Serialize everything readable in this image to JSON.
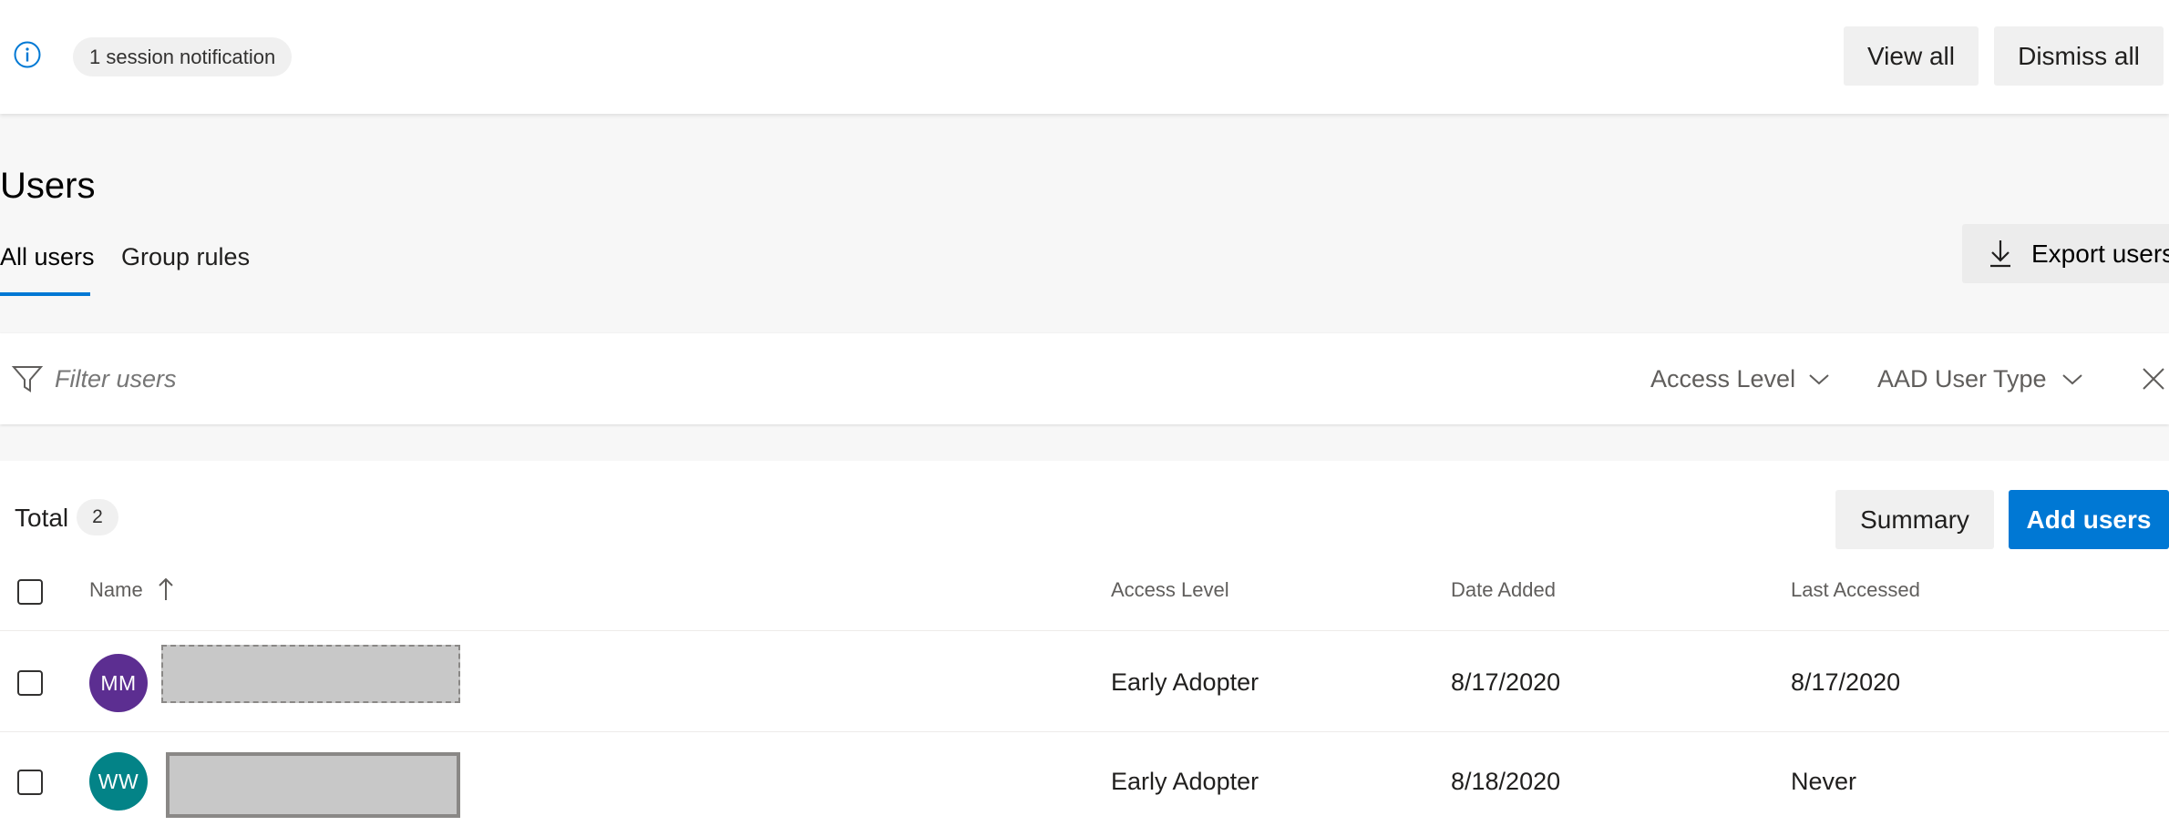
{
  "notification": {
    "text": "1 session notification",
    "view_all": "View all",
    "dismiss_all": "Dismiss all"
  },
  "page": {
    "title": "Users",
    "tabs": [
      {
        "label": "All users",
        "selected": true
      },
      {
        "label": "Group rules",
        "selected": false
      }
    ],
    "export_label": "Export users"
  },
  "filter": {
    "placeholder": "Filter users",
    "dropdowns": [
      {
        "label": "Access Level"
      },
      {
        "label": "AAD User Type"
      }
    ]
  },
  "list": {
    "total_label": "Total",
    "total_count": "2",
    "summary_label": "Summary",
    "add_users_label": "Add users",
    "columns": {
      "name": "Name",
      "access_level": "Access Level",
      "date_added": "Date Added",
      "last_accessed": "Last Accessed"
    },
    "rows": [
      {
        "initials": "MM",
        "avatar_color": "#5c2e91",
        "access_level": "Early Adopter",
        "date_added": "8/17/2020",
        "last_accessed": "8/17/2020"
      },
      {
        "initials": "WW",
        "avatar_color": "#038387",
        "access_level": "Early Adopter",
        "date_added": "8/18/2020",
        "last_accessed": "Never"
      }
    ]
  },
  "colors": {
    "accent": "#0078d4",
    "page_bg": "#f7f7f7"
  },
  "icons": {
    "info": "info-circle-icon",
    "export": "download-arrow-icon",
    "filter": "funnel-icon",
    "chevron": "chevron-down-icon",
    "clear": "close-icon",
    "sort": "arrow-up-icon"
  }
}
